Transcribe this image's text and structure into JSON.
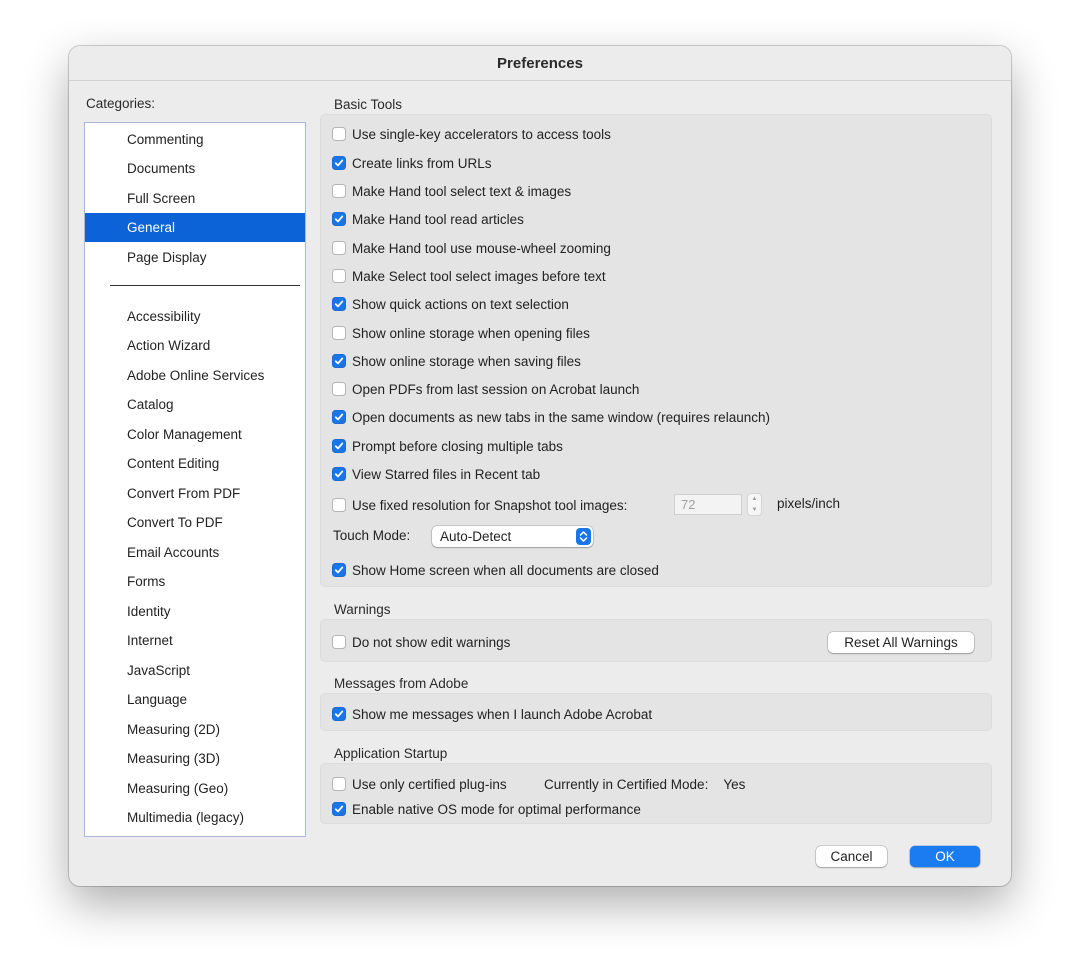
{
  "window": {
    "title": "Preferences"
  },
  "categories": {
    "label": "Categories:",
    "top_items": [
      "Commenting",
      "Documents",
      "Full Screen",
      "General",
      "Page Display"
    ],
    "selected": "General",
    "items": [
      "Accessibility",
      "Action Wizard",
      "Adobe Online Services",
      "Catalog",
      "Color Management",
      "Content Editing",
      "Convert From PDF",
      "Convert To PDF",
      "Email Accounts",
      "Forms",
      "Identity",
      "Internet",
      "JavaScript",
      "Language",
      "Measuring (2D)",
      "Measuring (3D)",
      "Measuring (Geo)",
      "Multimedia (legacy)"
    ]
  },
  "basic_tools": {
    "title": "Basic Tools",
    "options": [
      {
        "label": "Use single-key accelerators to access tools",
        "checked": false
      },
      {
        "label": "Create links from URLs",
        "checked": true
      },
      {
        "label": "Make Hand tool select text & images",
        "checked": false
      },
      {
        "label": "Make Hand tool read articles",
        "checked": true
      },
      {
        "label": "Make Hand tool use mouse-wheel zooming",
        "checked": false
      },
      {
        "label": "Make Select tool select images before text",
        "checked": false
      },
      {
        "label": "Show quick actions on text selection",
        "checked": true
      },
      {
        "label": "Show online storage when opening files",
        "checked": false
      },
      {
        "label": "Show online storage when saving files",
        "checked": true
      },
      {
        "label": "Open PDFs from last session on Acrobat launch",
        "checked": false
      },
      {
        "label": "Open documents as new tabs in the same window (requires relaunch)",
        "checked": true
      },
      {
        "label": "Prompt before closing multiple tabs",
        "checked": true
      },
      {
        "label": "View Starred files in Recent tab",
        "checked": true
      }
    ],
    "snapshot": {
      "label": "Use fixed resolution for Snapshot tool images:",
      "checked": false,
      "value": "72",
      "units": "pixels/inch"
    },
    "touch_mode": {
      "label": "Touch Mode:",
      "value": "Auto-Detect"
    },
    "home_screen": {
      "label": "Show Home screen when all documents are closed",
      "checked": true
    }
  },
  "warnings": {
    "title": "Warnings",
    "option": {
      "label": "Do not show edit warnings",
      "checked": false
    },
    "reset_button": "Reset All Warnings"
  },
  "messages": {
    "title": "Messages from Adobe",
    "option": {
      "label": "Show me messages when I launch Adobe Acrobat",
      "checked": true
    }
  },
  "startup": {
    "title": "Application Startup",
    "certified": {
      "label": "Use only certified plug-ins",
      "checked": false
    },
    "certified_mode_label": "Currently in Certified Mode:",
    "certified_mode_value": "Yes",
    "native_os": {
      "label": "Enable native OS mode for optimal performance",
      "checked": true
    }
  },
  "buttons": {
    "cancel": "Cancel",
    "ok": "OK"
  },
  "colors": {
    "accent": "#1a76e8",
    "selection": "#0b63d7",
    "window_bg": "#ececec",
    "group_bg": "#e4e4e4"
  }
}
